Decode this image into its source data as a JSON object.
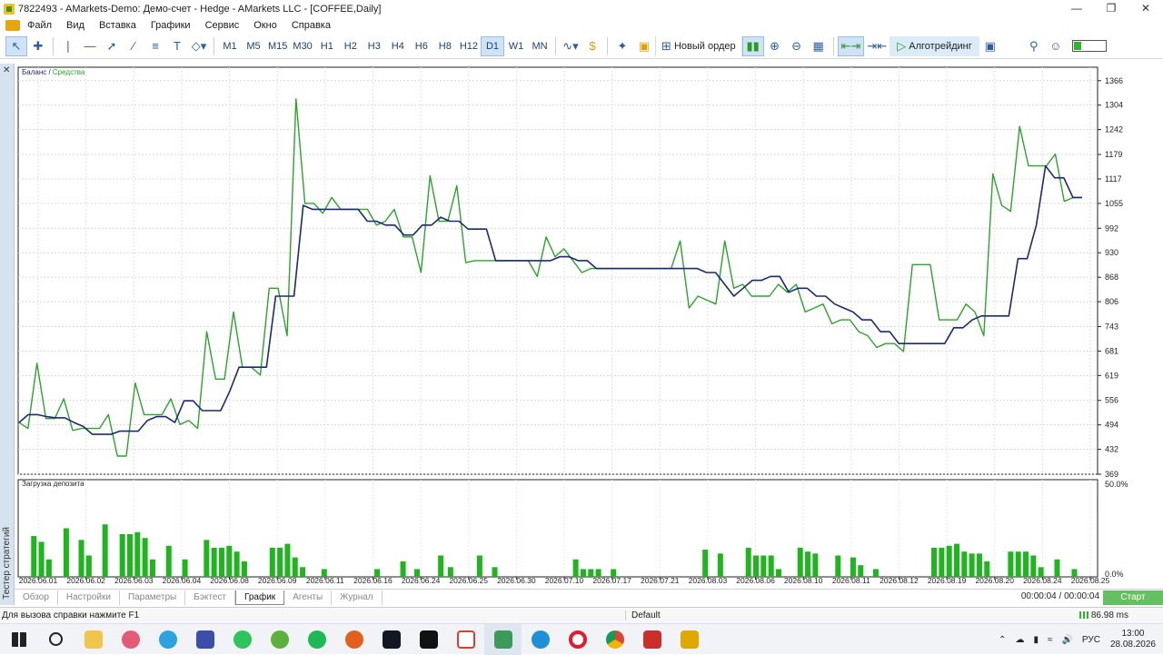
{
  "window": {
    "title": "7822493 - AMarkets-Demo: Демо-счет - Hedge - AMarkets LLC - [COFFEE,Daily]"
  },
  "menu": [
    "Файл",
    "Вид",
    "Вставка",
    "Графики",
    "Сервис",
    "Окно",
    "Справка"
  ],
  "toolbar": {
    "timeframes": [
      "M1",
      "M5",
      "M15",
      "M30",
      "H1",
      "H2",
      "H3",
      "H4",
      "H6",
      "H8",
      "H12",
      "D1",
      "W1",
      "MN"
    ],
    "selected_timeframe": "D1",
    "new_order_label": "Новый ордер",
    "algo_label": "Алготрейдинг"
  },
  "left_panel": {
    "label": "Тестер стратегий"
  },
  "chart": {
    "legend_balance": "Баланс",
    "legend_sep": " / ",
    "legend_equity": "Средства",
    "sub_label": "Загрузка депозита",
    "balance_color": "#1c2a73",
    "equity_color": "#2aa52a",
    "bar_color": "#1fb51f"
  },
  "chart_data": {
    "type": "line",
    "title": "",
    "y_ticks": [
      1366,
      1304,
      1242,
      1179,
      1117,
      1055,
      992,
      930,
      868,
      806,
      743,
      681,
      619,
      556,
      494,
      432,
      369
    ],
    "ylim": [
      369,
      1400
    ],
    "x_ticks": [
      "2026.06.01",
      "2026.06.02",
      "2026.06.03",
      "2026.06.04",
      "2026.06.08",
      "2026.06.09",
      "2026.06.11",
      "2026.06.16",
      "2026.06.24",
      "2026.06.25",
      "2026.06.30",
      "2026.07.10",
      "2026.07.17",
      "2026.07.21",
      "2026.08.03",
      "2026.08.06",
      "2026.08.10",
      "2026.08.11",
      "2026.08.12",
      "2026.08.19",
      "2026.08.20",
      "2026.08.24",
      "2026.08.25"
    ],
    "series": [
      {
        "name": "Баланс",
        "values": [
          500,
          520,
          520,
          515,
          512,
          512,
          500,
          490,
          470,
          470,
          470,
          478,
          478,
          478,
          505,
          515,
          515,
          500,
          555,
          555,
          530,
          530,
          530,
          580,
          640,
          640,
          640,
          640,
          820,
          820,
          820,
          1050,
          1040,
          1040,
          1040,
          1040,
          1040,
          1040,
          1010,
          1010,
          1000,
          1000,
          975,
          975,
          1000,
          1000,
          1020,
          1010,
          1010,
          990,
          990,
          990,
          910,
          910,
          910,
          910,
          910,
          910,
          910,
          920,
          920,
          910,
          910,
          890,
          890,
          890,
          890,
          890,
          890,
          890,
          890,
          890,
          890,
          890,
          890,
          880,
          880,
          850,
          820,
          840,
          860,
          860,
          870,
          870,
          830,
          840,
          840,
          820,
          820,
          800,
          790,
          780,
          760,
          760,
          730,
          730,
          700,
          700,
          700,
          700,
          700,
          700,
          740,
          740,
          760,
          770,
          770,
          770,
          770,
          915,
          915,
          1000,
          1150,
          1120,
          1120,
          1070,
          1070
        ]
      },
      {
        "name": "Средства",
        "values": [
          500,
          485,
          650,
          510,
          510,
          560,
          480,
          485,
          485,
          485,
          520,
          415,
          415,
          600,
          520,
          520,
          520,
          560,
          495,
          505,
          485,
          730,
          610,
          610,
          780,
          640,
          640,
          620,
          840,
          840,
          720,
          1320,
          1055,
          1055,
          1030,
          1070,
          1040,
          1040,
          1040,
          1040,
          1000,
          1010,
          1040,
          970,
          970,
          880,
          1125,
          1010,
          1010,
          1100,
          905,
          910,
          910,
          910,
          910,
          910,
          910,
          910,
          870,
          970,
          920,
          940,
          910,
          880,
          890,
          890,
          890,
          890,
          890,
          890,
          890,
          890,
          890,
          890,
          960,
          790,
          820,
          810,
          800,
          960,
          840,
          850,
          820,
          820,
          820,
          850,
          830,
          850,
          780,
          790,
          800,
          750,
          760,
          760,
          730,
          720,
          690,
          700,
          700,
          680,
          900,
          900,
          900,
          760,
          760,
          760,
          800,
          780,
          720,
          1130,
          1050,
          1035,
          1250,
          1150,
          1150,
          1150,
          1180,
          1060,
          1070,
          1070
        ]
      }
    ],
    "deposit_load": {
      "ylabel_top": "50.0%",
      "ylabel_bottom": "0.0%",
      "values": [
        20,
        17,
        8,
        24,
        0,
        18,
        10,
        0,
        26,
        0,
        21,
        21,
        21,
        18,
        8,
        15,
        0,
        8,
        0,
        0,
        0,
        0,
        0,
        0,
        16,
        14,
        14,
        15,
        12,
        8,
        0,
        0,
        15,
        15,
        17,
        10,
        6,
        0,
        0,
        0,
        3,
        0,
        0,
        0,
        0,
        0,
        0,
        3,
        0,
        0,
        7,
        3,
        0,
        0,
        0,
        10,
        5,
        0,
        0,
        0,
        0,
        10,
        7,
        0,
        0,
        0,
        0,
        0,
        0,
        0,
        0,
        0,
        0,
        0,
        0,
        0,
        0,
        0,
        0,
        0,
        0,
        0,
        0,
        0,
        0,
        0,
        0,
        0,
        0,
        0,
        0,
        0,
        0,
        0,
        0,
        0,
        0,
        0,
        0,
        0,
        0,
        0,
        0,
        0,
        0,
        0,
        0,
        0,
        0,
        0,
        0,
        0,
        0,
        0,
        0,
        0,
        0,
        0,
        0,
        0,
        0,
        0,
        0,
        0,
        0
      ],
      "bars": [
        {
          "x": 0.012,
          "v": 21
        },
        {
          "x": 0.019,
          "v": 18
        },
        {
          "x": 0.026,
          "v": 9
        },
        {
          "x": 0.042,
          "v": 25
        },
        {
          "x": 0.056,
          "v": 19
        },
        {
          "x": 0.063,
          "v": 11
        },
        {
          "x": 0.078,
          "v": 27
        },
        {
          "x": 0.094,
          "v": 22
        },
        {
          "x": 0.101,
          "v": 22
        },
        {
          "x": 0.108,
          "v": 23
        },
        {
          "x": 0.115,
          "v": 20
        },
        {
          "x": 0.122,
          "v": 9
        },
        {
          "x": 0.137,
          "v": 16
        },
        {
          "x": 0.152,
          "v": 9
        },
        {
          "x": 0.172,
          "v": 19
        },
        {
          "x": 0.179,
          "v": 15
        },
        {
          "x": 0.186,
          "v": 15
        },
        {
          "x": 0.193,
          "v": 16
        },
        {
          "x": 0.2,
          "v": 13
        },
        {
          "x": 0.207,
          "v": 8
        },
        {
          "x": 0.233,
          "v": 15
        },
        {
          "x": 0.24,
          "v": 15
        },
        {
          "x": 0.247,
          "v": 17
        },
        {
          "x": 0.254,
          "v": 10
        },
        {
          "x": 0.261,
          "v": 5
        },
        {
          "x": 0.281,
          "v": 4
        },
        {
          "x": 0.33,
          "v": 4
        },
        {
          "x": 0.354,
          "v": 8
        },
        {
          "x": 0.367,
          "v": 4
        },
        {
          "x": 0.389,
          "v": 11
        },
        {
          "x": 0.398,
          "v": 5
        },
        {
          "x": 0.425,
          "v": 11
        },
        {
          "x": 0.439,
          "v": 5
        },
        {
          "x": 0.514,
          "v": 9
        },
        {
          "x": 0.521,
          "v": 4
        },
        {
          "x": 0.528,
          "v": 4
        },
        {
          "x": 0.535,
          "v": 4
        },
        {
          "x": 0.549,
          "v": 4
        },
        {
          "x": 0.634,
          "v": 14
        },
        {
          "x": 0.648,
          "v": 12
        },
        {
          "x": 0.674,
          "v": 15
        },
        {
          "x": 0.681,
          "v": 11
        },
        {
          "x": 0.688,
          "v": 11
        },
        {
          "x": 0.695,
          "v": 11
        },
        {
          "x": 0.702,
          "v": 4
        },
        {
          "x": 0.722,
          "v": 15
        },
        {
          "x": 0.729,
          "v": 13
        },
        {
          "x": 0.736,
          "v": 12
        },
        {
          "x": 0.757,
          "v": 11
        },
        {
          "x": 0.771,
          "v": 10
        },
        {
          "x": 0.778,
          "v": 6
        },
        {
          "x": 0.792,
          "v": 4
        },
        {
          "x": 0.846,
          "v": 15
        },
        {
          "x": 0.853,
          "v": 15
        },
        {
          "x": 0.86,
          "v": 16
        },
        {
          "x": 0.867,
          "v": 17
        },
        {
          "x": 0.874,
          "v": 13
        },
        {
          "x": 0.881,
          "v": 12
        },
        {
          "x": 0.888,
          "v": 12
        },
        {
          "x": 0.895,
          "v": 8
        },
        {
          "x": 0.917,
          "v": 13
        },
        {
          "x": 0.924,
          "v": 13
        },
        {
          "x": 0.931,
          "v": 13
        },
        {
          "x": 0.938,
          "v": 11
        },
        {
          "x": 0.945,
          "v": 5
        },
        {
          "x": 0.96,
          "v": 9
        },
        {
          "x": 0.976,
          "v": 4
        }
      ]
    }
  },
  "tabs": [
    "Обзор",
    "Настройки",
    "Параметры",
    "Бэктест",
    "График",
    "Агенты",
    "Журнал"
  ],
  "active_tab": "График",
  "tester": {
    "timer": "00:00:04 / 00:00:04",
    "start_label": "Старт"
  },
  "status": {
    "help": "Для вызова справки нажмите F1",
    "profile": "Default",
    "ping": "86.98 ms"
  },
  "tray": {
    "lang": "РУС",
    "time": "13:00",
    "date": "28.08.2026"
  }
}
